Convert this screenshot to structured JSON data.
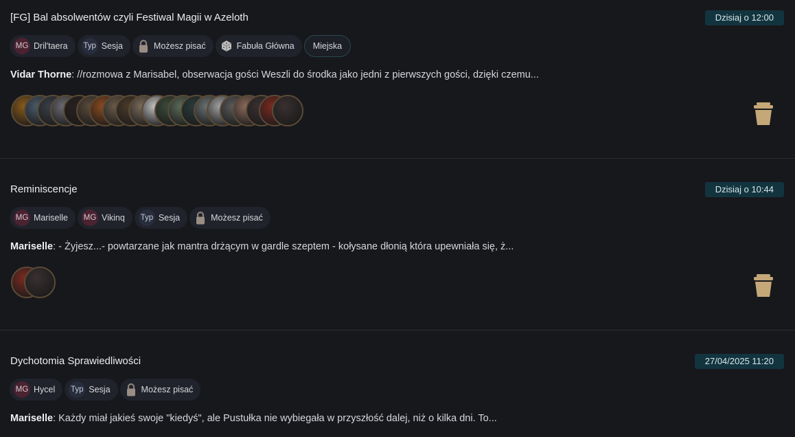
{
  "threads": [
    {
      "title": "[FG] Bal absolwentów czyli Festiwal Magii w Azeloth",
      "date": "Dzisiaj o 12:00",
      "tags": [
        {
          "kind": "mg",
          "prefix": "MG",
          "label": "Dril'taera"
        },
        {
          "kind": "typ",
          "prefix": "Typ",
          "label": "Sesja"
        },
        {
          "kind": "lock",
          "icon": "padlock-icon",
          "label": "Możesz pisać"
        },
        {
          "kind": "dice",
          "icon": "dice-icon",
          "label": "Fabuła Główna"
        },
        {
          "kind": "outlined",
          "label": "Miejska"
        }
      ],
      "author": "Vidar Thorne",
      "snippet": ": //rozmowa z Marisabel, obserwacja gości Weszli do środka jako jedni z pierwszych gości, dzięki czemu...",
      "avatar_colors": [
        "#8a5a1a",
        "#4a5a6a",
        "#3a4048",
        "#6a6a70",
        "#2a2020",
        "#5a4a3a",
        "#8a4a20",
        "#6a5a4a",
        "#4a3a2a",
        "#7a6a5a",
        "#c0c0c0",
        "#3a4a3a",
        "#5a6a5a",
        "#2a3a3a",
        "#6a7070",
        "#a0a0a0",
        "#5a5a5a",
        "#8a6a5a",
        "#3a3030",
        "#7a2a20",
        "#3a3030"
      ]
    },
    {
      "title": "Reminiscencje",
      "date": "Dzisiaj o 10:44",
      "tags": [
        {
          "kind": "mg",
          "prefix": "MG",
          "label": "Mariselle"
        },
        {
          "kind": "mg",
          "prefix": "MG",
          "label": "Vikinq"
        },
        {
          "kind": "typ",
          "prefix": "Typ",
          "label": "Sesja"
        },
        {
          "kind": "lock",
          "icon": "padlock-icon",
          "label": "Możesz pisać"
        }
      ],
      "author": "Mariselle",
      "snippet": ": - Żyjesz...- powtarzane jak mantra drżącym w gardle szeptem - kołysane dłonią która upewniała się, ż...",
      "avatar_colors": [
        "#7a2a20",
        "#3a3030"
      ]
    },
    {
      "title": "Dychotomia Sprawiedliwości",
      "date": "27/04/2025 11:20",
      "tags": [
        {
          "kind": "mg",
          "prefix": "MG",
          "label": "Hycel"
        },
        {
          "kind": "typ",
          "prefix": "Typ",
          "label": "Sesja"
        },
        {
          "kind": "lock",
          "icon": "padlock-icon",
          "label": "Możesz pisać"
        }
      ],
      "author": "Mariselle",
      "snippet": ": Każdy miał jakieś swoje \"kiedyś\", ale Pustułka nie wybiegała w przyszłość dalej, niż o kilka dni. To...",
      "avatar_colors": []
    }
  ],
  "colors": {
    "background": "#17181c",
    "date_badge": "#12343f",
    "mg_prefix": "#4a2230",
    "trash": "#c4a878"
  }
}
